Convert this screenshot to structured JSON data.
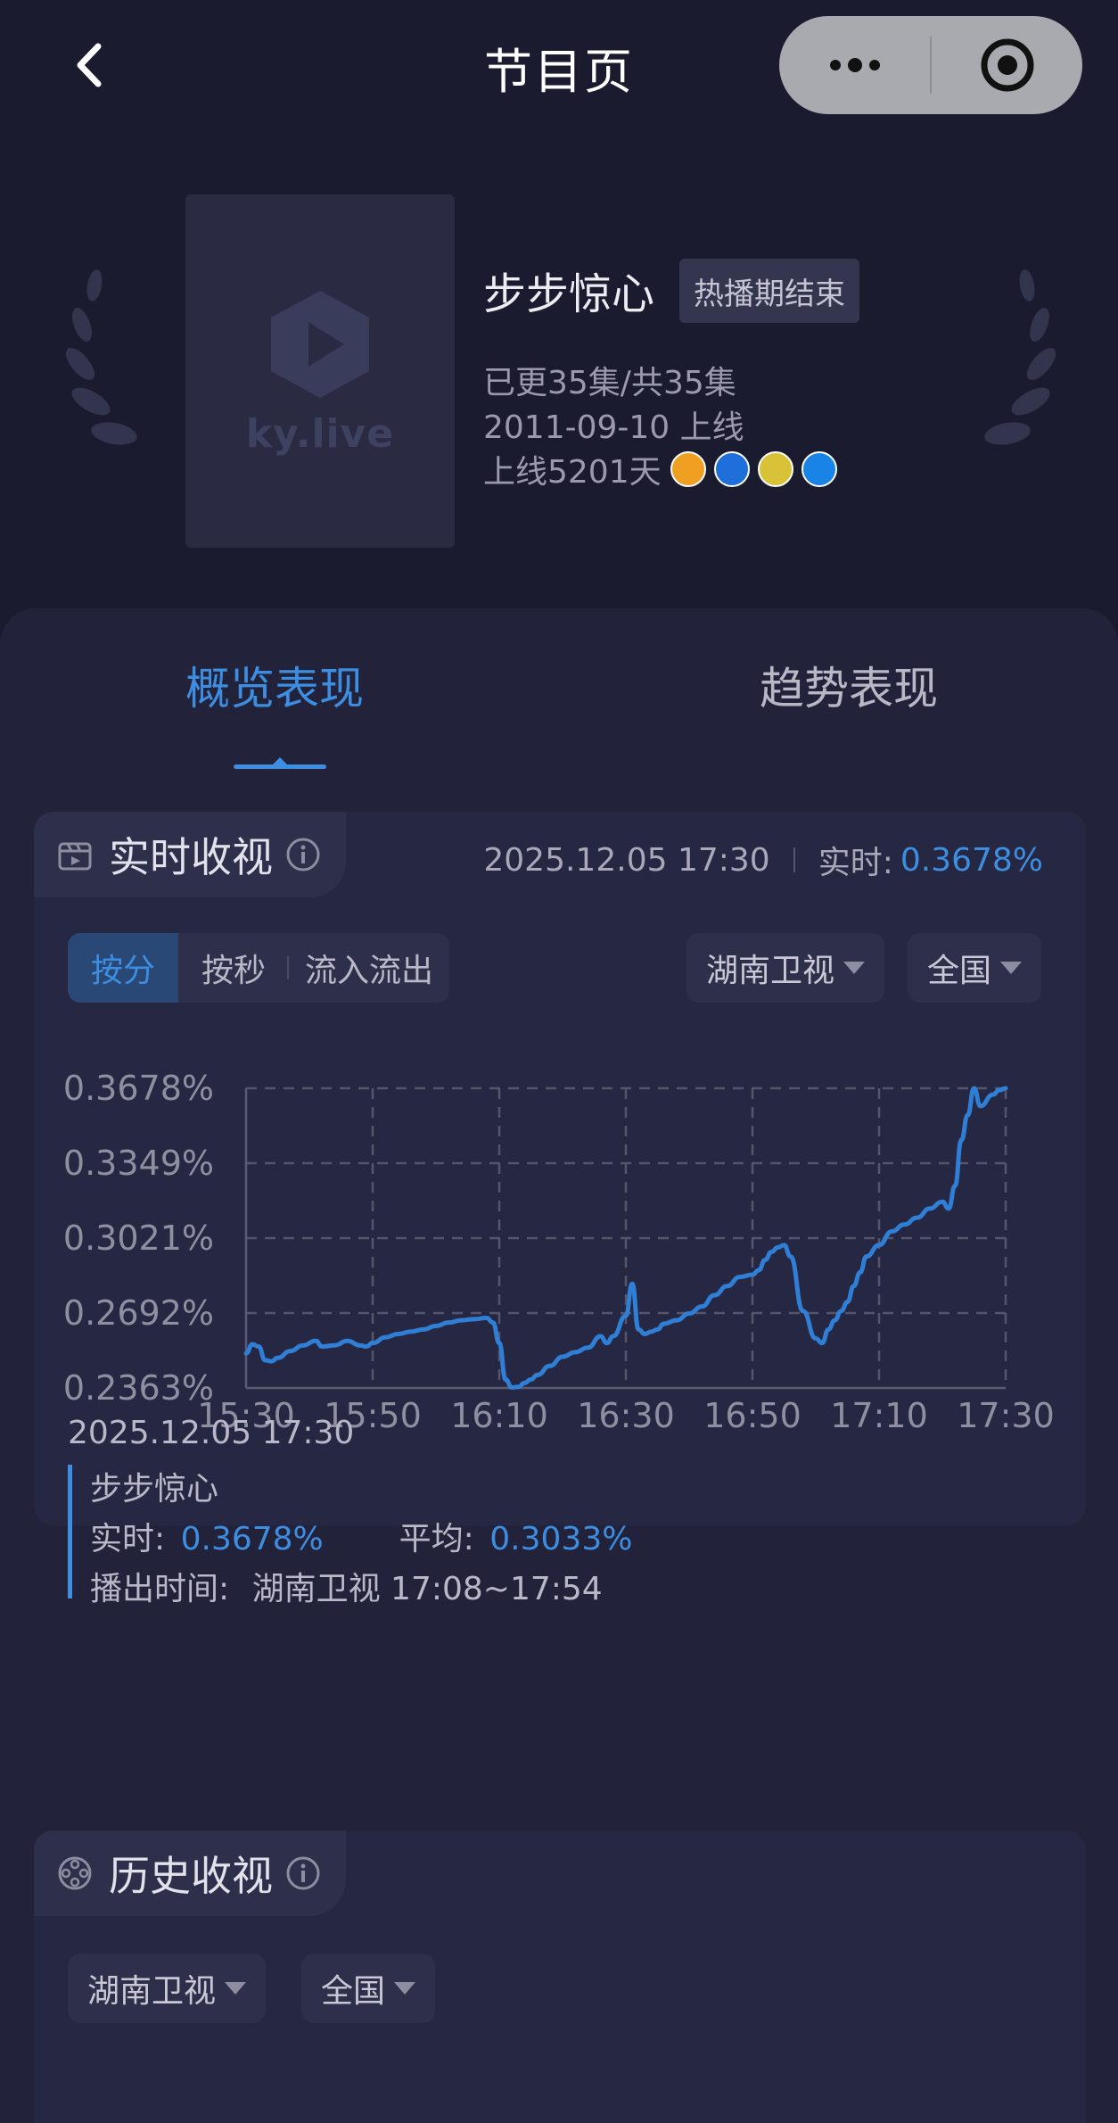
{
  "nav": {
    "title": "节目页",
    "back_icon": "chevron-left-icon",
    "more_icon": "more-dots-icon",
    "target_icon": "target-icon"
  },
  "program": {
    "title": "步步惊心",
    "status": "热播期结束",
    "episodes": "已更35集/共35集",
    "release": "2011-09-10 上线",
    "days_online": "上线5201天",
    "poster_text": "ky.live",
    "channel_icons": [
      "#f0a020",
      "#1e6fd9",
      "#d8c238",
      "#1a84e6"
    ]
  },
  "tabs": [
    {
      "label": "概览表现",
      "active": true
    },
    {
      "label": "趋势表现",
      "active": false
    }
  ],
  "realtime": {
    "title": "实时收视",
    "datetime": "2025.12.05 17:30",
    "rt_label": "实时:",
    "rt_value": "0.3678%",
    "modes": [
      "按分",
      "按秒",
      "流入流出"
    ],
    "active_mode": "按分",
    "channel": "湖南卫视",
    "region": "全国",
    "detail": {
      "ts": "2025.12.05 17:30",
      "name": "步步惊心",
      "rt_label": "实时:",
      "rt_value": "0.3678%",
      "avg_label": "平均:",
      "avg_value": "0.3033%",
      "airtime_label": "播出时间:",
      "airtime_value": "湖南卫视 17:08~17:54"
    }
  },
  "history": {
    "title": "历史收视",
    "channel": "湖南卫视",
    "region": "全国"
  },
  "colors": {
    "accent": "#3d8de0",
    "bg": "#1b1b2f",
    "card": "#262742"
  },
  "chart_data": {
    "type": "line",
    "x_tick_labels": [
      "15:30",
      "15:50",
      "16:10",
      "16:30",
      "16:50",
      "17:10",
      "17:30"
    ],
    "y_tick_labels": [
      "0.3678%",
      "0.3349%",
      "0.3021%",
      "0.2692%",
      "0.2363%"
    ],
    "ylim": [
      0.2363,
      0.3678
    ],
    "grid": true,
    "series": [
      {
        "color": "#2f7fd6",
        "x": [
          "15:30",
          "15:31",
          "15:32",
          "15:33",
          "15:34",
          "15:35",
          "15:37",
          "15:39",
          "15:41",
          "15:42",
          "15:44",
          "15:46",
          "15:48",
          "15:49",
          "15:50",
          "15:52",
          "15:54",
          "15:56",
          "15:58",
          "16:00",
          "16:02",
          "16:04",
          "16:06",
          "16:08",
          "16:09",
          "16:10",
          "16:11",
          "16:12",
          "16:13",
          "16:14",
          "16:15",
          "16:16",
          "16:18",
          "16:20",
          "16:22",
          "16:24",
          "16:26",
          "16:27",
          "16:28",
          "16:30",
          "16:31",
          "16:32",
          "16:33",
          "16:34",
          "16:35",
          "16:36",
          "16:38",
          "16:40",
          "16:42",
          "16:44",
          "16:46",
          "16:48",
          "16:50",
          "16:51",
          "16:52",
          "16:53",
          "16:54",
          "16:55",
          "16:56",
          "16:58",
          "17:00",
          "17:01",
          "17:02",
          "17:03",
          "17:04",
          "17:05",
          "17:06",
          "17:07",
          "17:08",
          "17:10",
          "17:12",
          "17:14",
          "17:16",
          "17:18",
          "17:20",
          "17:21",
          "17:22",
          "17:23",
          "17:24",
          "17:25",
          "17:26",
          "17:28",
          "17:29",
          "17:30"
        ],
        "y": [
          0.2515,
          0.2555,
          0.2545,
          0.2485,
          0.248,
          0.2495,
          0.2525,
          0.255,
          0.257,
          0.2545,
          0.255,
          0.257,
          0.255,
          0.2545,
          0.256,
          0.2585,
          0.26,
          0.261,
          0.262,
          0.2635,
          0.265,
          0.266,
          0.2665,
          0.267,
          0.265,
          0.256,
          0.24,
          0.2365,
          0.2368,
          0.2385,
          0.24,
          0.242,
          0.246,
          0.25,
          0.252,
          0.254,
          0.259,
          0.256,
          0.259,
          0.268,
          0.282,
          0.262,
          0.26,
          0.261,
          0.262,
          0.2645,
          0.266,
          0.269,
          0.272,
          0.277,
          0.281,
          0.285,
          0.286,
          0.288,
          0.2925,
          0.296,
          0.298,
          0.299,
          0.294,
          0.27,
          0.258,
          0.256,
          0.262,
          0.266,
          0.27,
          0.274,
          0.281,
          0.287,
          0.294,
          0.299,
          0.305,
          0.308,
          0.311,
          0.315,
          0.318,
          0.315,
          0.325,
          0.345,
          0.356,
          0.3678,
          0.36,
          0.365,
          0.367,
          0.3678
        ]
      }
    ]
  }
}
